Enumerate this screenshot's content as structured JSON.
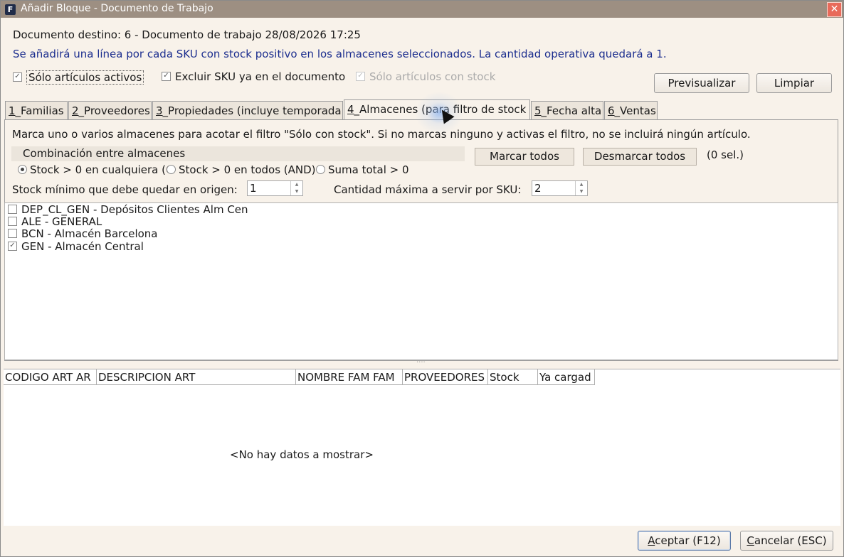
{
  "window": {
    "title": "Añadir Bloque - Documento de Trabajo",
    "app_icon": "F",
    "close_glyph": "✕"
  },
  "header": {
    "destination": "Documento destino: 6 - Documento de trabajo 28/08/2026 17:25",
    "info": "Se añadirá una línea por cada SKU con stock positivo en los almacenes seleccionados. La cantidad operativa quedará a 1."
  },
  "filters": {
    "only_active": {
      "label": "Sólo artículos activos",
      "checked": true
    },
    "exclude_sku": {
      "label": "Excluir SKU ya en el documento",
      "checked": true
    },
    "only_stock": {
      "label": "Sólo artículos con stock",
      "checked": true,
      "disabled": true
    }
  },
  "buttons": {
    "preview": "Previsualizar",
    "clear": "Limpiar",
    "accept_key": "A",
    "accept_rest": "ceptar (F12)",
    "cancel_key": "C",
    "cancel_rest": "ancelar (ESC)"
  },
  "tabs": [
    {
      "num": "1",
      "label": "_Familias"
    },
    {
      "num": "2",
      "label": "_Proveedores"
    },
    {
      "num": "3",
      "label": "_Propiedades (incluye temporada"
    },
    {
      "num": "4",
      "label": "_Almacenes (para filtro de stock"
    },
    {
      "num": "5",
      "label": "_Fecha alta"
    },
    {
      "num": "6",
      "label": "_Ventas"
    }
  ],
  "warehouses_tab": {
    "hint": "Marca uno o varios almacenes para acotar el filtro \"Sólo con stock\". Si no marcas ninguno y activas el filtro, no se incluirá ningún artículo.",
    "combination_title": "Combinación entre almacenes",
    "radios": [
      {
        "label": "Stock > 0 en cualquiera (O",
        "selected": true
      },
      {
        "label": "Stock > 0 en todos (AND)",
        "selected": false
      },
      {
        "label": "Suma total > 0",
        "selected": false
      }
    ],
    "mark_all": "Marcar todos",
    "unmark_all": "Desmarcar todos",
    "selected_count": "(0 sel.)",
    "min_stock_label": "Stock mínimo que debe quedar en origen:",
    "min_stock_value": "1",
    "max_qty_label": "Cantidad máxima a servir por SKU:",
    "max_qty_value": "2",
    "warehouses": [
      {
        "label": "DEP_CL_GEN - Depósitos Clientes Alm Cen",
        "checked": false
      },
      {
        "label": "ALE - GENERAL",
        "checked": false
      },
      {
        "label": "BCN - Almacén Barcelona",
        "checked": false
      },
      {
        "label": "GEN - Almacén Central",
        "checked": true
      }
    ]
  },
  "splitter_grip": "....",
  "grid": {
    "columns": [
      "CODIGO ART AR",
      "DESCRIPCION ART",
      "NOMBRE FAM FAM",
      "PROVEEDORES",
      "Stock",
      "Ya cargad"
    ],
    "empty_text": "<No hay datos a mostrar>"
  }
}
